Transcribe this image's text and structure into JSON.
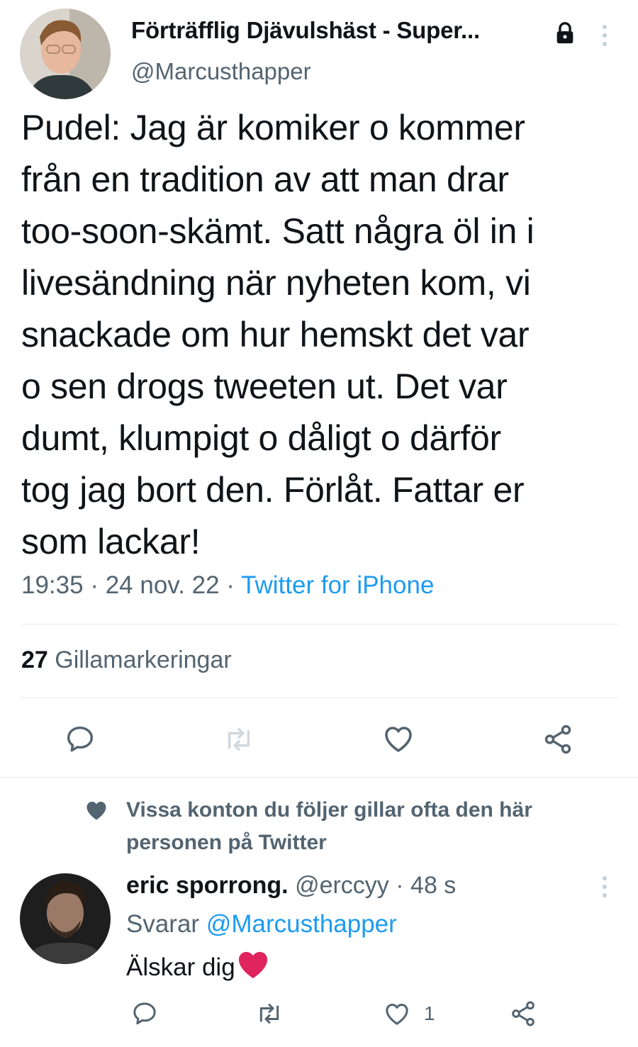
{
  "tweet": {
    "author_name": "Förträfflig Djävulshäst - Super...",
    "author_handle": "@Marcusthapper",
    "text_lines": [
      "Pudel: Jag är komiker o kommer",
      "från en tradition av att man drar",
      "too-soon-skämt. Satt några öl in i",
      "livesändning när nyheten kom, vi",
      "snackade om hur hemskt det var",
      "o sen drogs tweeten ut. Det var",
      "dumt, klumpigt o dåligt o därför",
      "tog jag bort den. Förlåt. Fattar er",
      "som lackar!"
    ],
    "time": "19:35",
    "date": "24 nov. 22",
    "source": "Twitter for iPhone",
    "likes_count": "27",
    "likes_label": "Gillamarkeringar"
  },
  "social_context": {
    "text": "Vissa konton du följer gillar ofta den här personen på Twitter"
  },
  "reply": {
    "author_name": "eric sporrong.",
    "author_handle": "@erccyy",
    "age": "48 s",
    "replying_prefix": "Svarar",
    "replying_to": "@Marcusthapper",
    "text": "Älskar dig",
    "like_count": "1"
  },
  "icons": {
    "lock": "lock-icon",
    "more": "more-vertical-icon",
    "reply": "reply-icon",
    "retweet": "retweet-icon",
    "like": "heart-outline-icon",
    "share": "share-icon",
    "context_heart": "heart-filled-icon",
    "emoji": "red-heart-emoji"
  },
  "colors": {
    "text": "#0f1419",
    "secondary": "#536471",
    "link": "#1d9bf0",
    "divider": "#e7e9ea",
    "emoji_heart": "#e0245e"
  }
}
